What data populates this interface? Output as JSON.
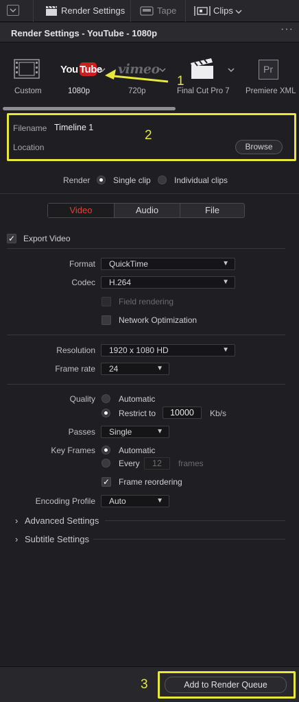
{
  "topbar": {
    "render_settings": "Render Settings",
    "tape": "Tape",
    "clips": "Clips"
  },
  "title": "Render Settings - YouTube - 1080p",
  "presets": [
    {
      "label": "Custom",
      "icon": "film-strip-icon"
    },
    {
      "label": "1080p",
      "icon": "youtube-logo",
      "logo_text": "YouTube",
      "selected": true
    },
    {
      "label": "720p",
      "icon": "vimeo-logo",
      "logo_text": "vimeo"
    },
    {
      "label": "Final Cut Pro 7",
      "icon": "clapperboard-icon"
    },
    {
      "label": "Premiere XML",
      "icon": "premiere-icon",
      "logo_text": "Pr"
    }
  ],
  "file": {
    "filename_label": "Filename",
    "filename_value": "Timeline 1",
    "location_label": "Location",
    "browse_label": "Browse"
  },
  "render": {
    "label": "Render",
    "single": "Single clip",
    "individual": "Individual clips"
  },
  "tabs": [
    "Video",
    "Audio",
    "File"
  ],
  "export_video": "Export Video",
  "format": {
    "label": "Format",
    "value": "QuickTime"
  },
  "codec": {
    "label": "Codec",
    "value": "H.264"
  },
  "field_rendering": "Field rendering",
  "network_optimization": "Network Optimization",
  "resolution": {
    "label": "Resolution",
    "value": "1920 x 1080 HD"
  },
  "frame_rate": {
    "label": "Frame rate",
    "value": "24"
  },
  "quality": {
    "label": "Quality",
    "automatic": "Automatic",
    "restrict_to": "Restrict to",
    "value": "10000",
    "unit": "Kb/s"
  },
  "passes": {
    "label": "Passes",
    "value": "Single"
  },
  "key_frames": {
    "label": "Key Frames",
    "automatic": "Automatic",
    "every": "Every",
    "every_value": "12",
    "frames": "frames"
  },
  "frame_reordering": "Frame reordering",
  "encoding_profile": {
    "label": "Encoding Profile",
    "value": "Auto"
  },
  "advanced_settings": "Advanced Settings",
  "subtitle_settings": "Subtitle Settings",
  "add_to_queue": "Add to Render Queue",
  "annotations": [
    "1",
    "2",
    "3"
  ],
  "colors": {
    "highlight": "#e8e83a",
    "active_tab": "#e0403a",
    "youtube_red": "#cc1f1f"
  }
}
